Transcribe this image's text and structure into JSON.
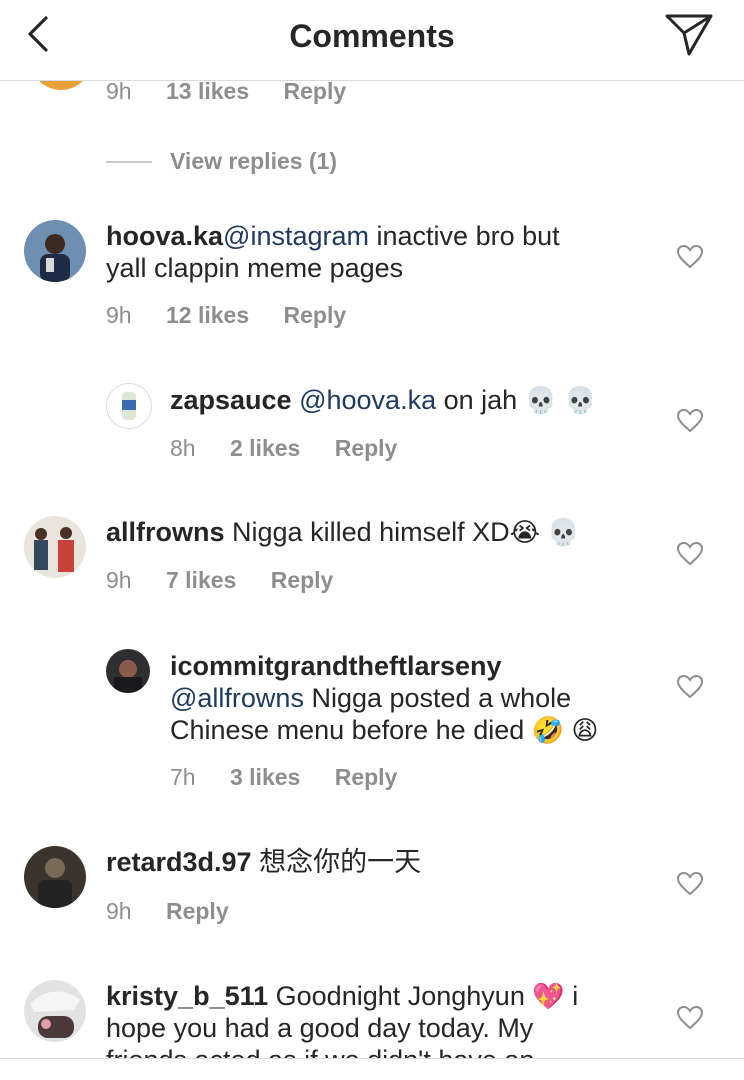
{
  "header": {
    "title": "Comments"
  },
  "top_meta": {
    "time": "9h",
    "likes": "13 likes",
    "reply": "Reply"
  },
  "view_replies": "View replies (1)",
  "comments": [
    {
      "username": "hoova.ka",
      "mention": "@instagram",
      "text_line1": " inactive bro but",
      "text_line2": "yall clappin meme pages",
      "time": "9h",
      "likes": "12 likes",
      "reply": "Reply"
    },
    {
      "username": "zapsauce",
      "mention": "@hoova.ka",
      "text": " on jah ",
      "emoji": "💀 💀",
      "time": "8h",
      "likes": "2 likes",
      "reply": "Reply"
    },
    {
      "username": "allfrowns",
      "text": " Nigga killed himself XD",
      "emoji": "😭 💀",
      "time": "9h",
      "likes": "7 likes",
      "reply": "Reply"
    },
    {
      "username": "icommitgrandtheftlarseny",
      "mention": "@allfrowns",
      "text_line1": " Nigga posted a whole",
      "text_line2": "Chinese menu before he died ",
      "emoji": "🤣 😩",
      "time": "7h",
      "likes": "3 likes",
      "reply": "Reply"
    },
    {
      "username": "retard3d.97",
      "text": " 想念你的一天",
      "time": "9h",
      "reply": "Reply"
    },
    {
      "username": "kristy_b_511",
      "text_line1": " Goodnight Jonghyun ",
      "emoji": "💖",
      "text_line1_end": " i",
      "text_line2": "hope you had a good day today. My",
      "text_line3": "friends acted as if we didn't have an"
    }
  ],
  "colors": {
    "mention": "#1e3a5f",
    "meta": "#8e8e8e",
    "divider": "#dbdbdb"
  }
}
